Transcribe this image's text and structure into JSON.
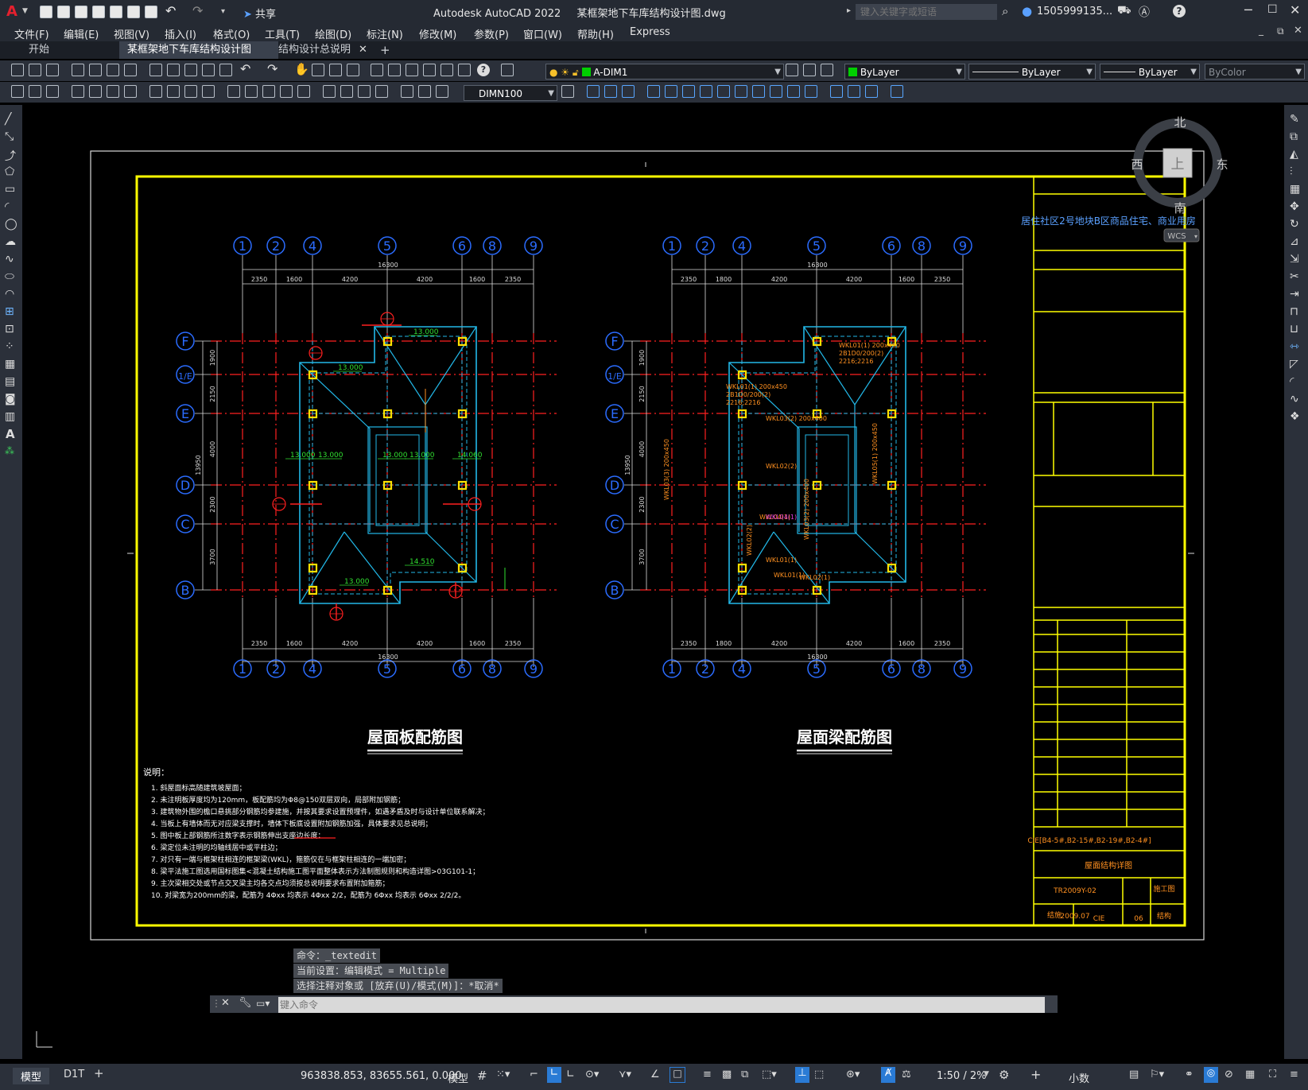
{
  "window": {
    "app_title": "Autodesk AutoCAD 2022",
    "file_title": "某框架地下车库结构设计图.dwg",
    "share_label": "共享",
    "search_placeholder": "键入关键字或短语",
    "user": "1505999135...",
    "help": "?"
  },
  "menu": [
    "文件(F)",
    "编辑(E)",
    "视图(V)",
    "插入(I)",
    "格式(O)",
    "工具(T)",
    "绘图(D)",
    "标注(N)",
    "修改(M)",
    "参数(P)",
    "窗口(W)",
    "帮助(H)",
    "Express"
  ],
  "tabs": [
    {
      "label": "开始"
    },
    {
      "label": "某框架地下车库结构设计图*"
    },
    {
      "label": "结构设计总说明"
    }
  ],
  "toolbar": {
    "layer": "A-DIM1",
    "color": "ByLayer",
    "linetype": "ByLayer",
    "lineweight": "ByLayer",
    "plotstyle": "ByColor",
    "dimstyle": "DIMN100"
  },
  "viewcube": {
    "north": "北",
    "south": "南",
    "east": "东",
    "west": "西",
    "top": "上",
    "wcs": "WCS"
  },
  "drawing": {
    "plan_left_title": "屋面板配筋图",
    "plan_right_title": "屋面梁配筋图",
    "axis_cols": [
      "1",
      "2",
      "4",
      "5",
      "6",
      "8",
      "9"
    ],
    "axis_rows": [
      "F",
      "1/E",
      "E",
      "D",
      "C",
      "B"
    ],
    "dims_top": [
      "2350",
      "1600",
      "4200",
      "4200",
      "1600",
      "2350"
    ],
    "total_width": "16300",
    "dims_left": [
      "1900",
      "2150",
      "4000",
      "2300",
      "3700"
    ],
    "total_height": "13950",
    "dims_right_top": [
      "2350",
      "1800",
      "4200",
      "4200",
      "1600",
      "2350"
    ],
    "slab_elevations": [
      "13.000",
      "13.000",
      "13.000",
      "13.000",
      "13.000",
      "14.060",
      "14.510",
      "13.000",
      "13.000"
    ],
    "beam_labels": [
      "WKL01(1) 200x450",
      "2B1D0/200(2)",
      "2216;2216",
      "WKL03(2) 200x400",
      "WKL02(2)",
      "WKL04(1)",
      "WKL01(1)",
      "WKL02(1)",
      "WKL03(3) 200x450",
      "WKL05(1) 200x450"
    ],
    "notes_title": "说明：",
    "notes": [
      "1. 斜屋面标高随建筑坡屋面；",
      "2. 未注明板厚度均为120mm，板配筋均为Φ8@150双层双向，局部附加钢筋；",
      "3. 建筑物外围的檐口悬挑部分钢筋均参建施，并按其要求设置预埋件，如遇矛盾及时与设计单位联系解决；",
      "4. 当板上有墙体而无对应梁支撑时，墙体下板底设置附加钢筋加强，具体要求见总说明；",
      "5. 图中板上部钢筋所注数字表示钢筋伸出支座边长度：",
      "6. 梁定位未注明的均轴线居中或平柱边；",
      "7. 对只有一端与框架柱相连的框架梁(WKL)，箍筋仅在与框架柱相连的一端加密；",
      "8. 梁平法施工图选用国标图集<混凝土结构施工图平面整体表示方法制图规则和构造详图>03G101-1；",
      "9. 主次梁相交处或节点交叉梁主均各交点均须按总说明要求布置附加箍筋；",
      "10. 对梁宽为200mm的梁，配筋为 4Φxx 均表示 4Φxx 2/2，配筋为 6Φxx 均表示 6Φxx 2/2/2。"
    ],
    "titleblock_project": "居住社区2号地块B区商品住宅、商业用房",
    "titleblock_code": "CIE[B4-5#,B2-15#,B2-19#,B2-4#]",
    "titleblock_drawing": "屋面结构详图",
    "titleblock_no": "TR2009Y-02",
    "titleblock_stage": "施工图",
    "titleblock_date": "2009.07",
    "titleblock_discipline": "结构",
    "titleblock_foot": [
      "结施",
      "CIE",
      "06"
    ]
  },
  "command": {
    "line1": "命令：_textedit",
    "line2": "当前设置：编辑模式 = Multiple",
    "line3": "选择注释对象或 [放弃(U)/模式(M)]：*取消*",
    "placeholder": "键入命令"
  },
  "status": {
    "layout_tabs": [
      "模型",
      "D1T"
    ],
    "coords": "963838.853, 83655.561, 0.000",
    "model": "模型",
    "scale": "1:50 / 2%",
    "units": "小数"
  }
}
